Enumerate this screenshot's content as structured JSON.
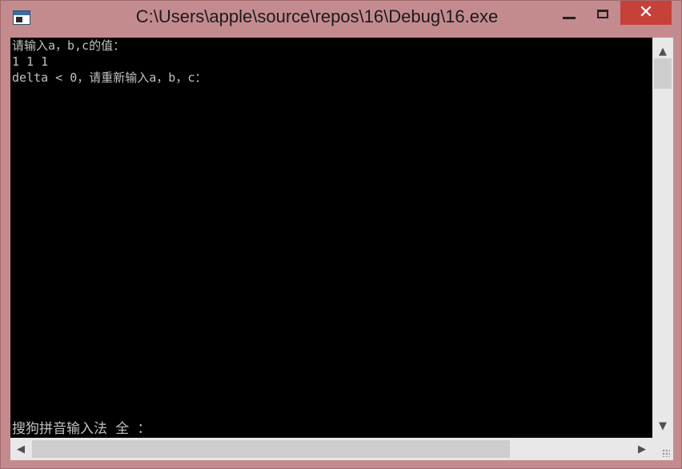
{
  "window": {
    "title": "C:\\Users\\apple\\source\\repos\\16\\Debug\\16.exe",
    "controls": {
      "minimize": "minimize",
      "maximize": "maximize",
      "close": "✕"
    }
  },
  "console": {
    "lines": [
      "请输入a，b,c的值：",
      "1 1 1",
      "delta < 0，请重新输入a，b，c："
    ],
    "ime_status": "搜狗拼音输入法 全 ："
  },
  "scrollbars": {
    "up_arrow": "▲",
    "down_arrow": "▼",
    "left_arrow": "◀",
    "right_arrow": "▶"
  },
  "colors": {
    "frame": "#c48b8f",
    "close_button": "#c7403a",
    "console_bg": "#000000",
    "console_text": "#c0c0c0"
  }
}
